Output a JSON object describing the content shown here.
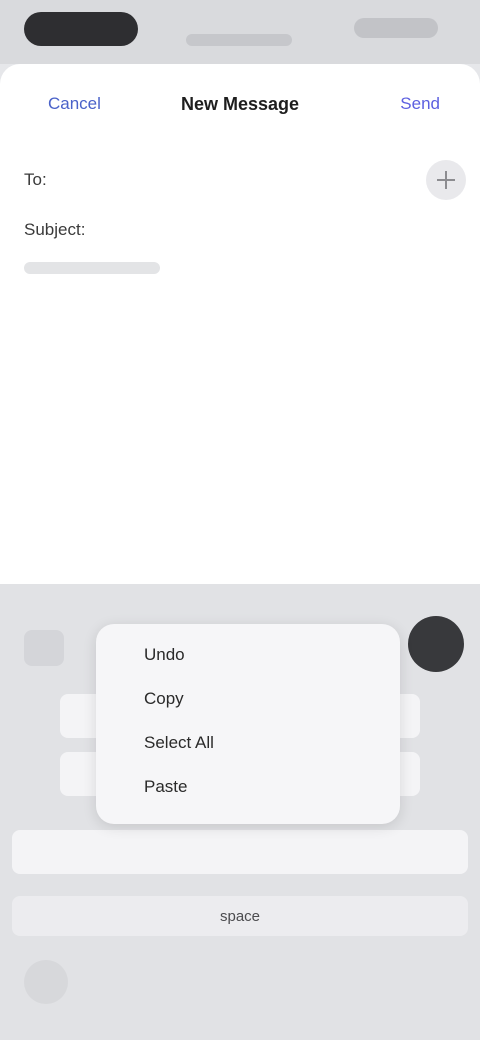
{
  "navbar": {
    "cancel_label": "Cancel",
    "title": "New Message",
    "action_label": "Send"
  },
  "compose": {
    "to_label": "To:",
    "subject_label": "Subject:",
    "body_placeholder": ""
  },
  "popup_menu": {
    "items": [
      {
        "label": "Undo"
      },
      {
        "label": "Copy"
      },
      {
        "label": "Select All"
      },
      {
        "label": "Paste"
      }
    ]
  },
  "keyboard": {
    "space_label": "space"
  },
  "colors": {
    "accent": "#4a62c9",
    "background": "#e6e7ea"
  }
}
